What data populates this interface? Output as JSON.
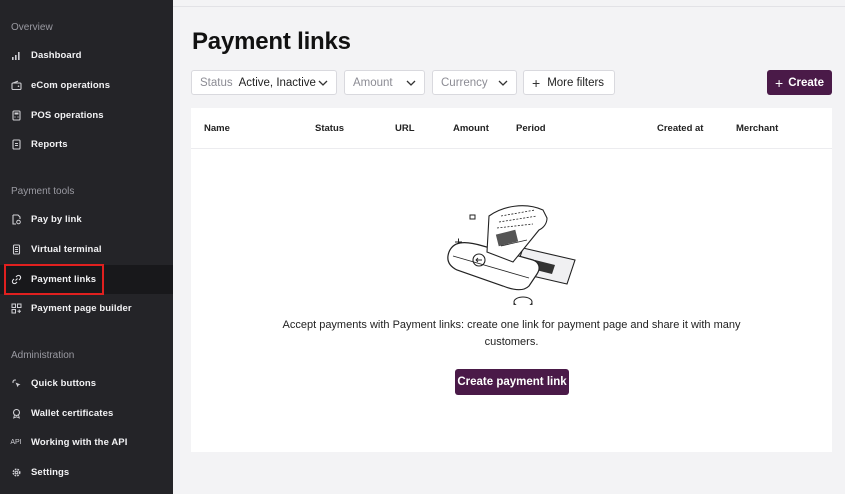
{
  "sidebar": {
    "sections": [
      {
        "title": "Overview",
        "items": [
          {
            "label": "Dashboard",
            "icon": "bar-chart-icon"
          },
          {
            "label": "eCom operations",
            "icon": "wallet-icon"
          },
          {
            "label": "POS operations",
            "icon": "pos-terminal-icon"
          },
          {
            "label": "Reports",
            "icon": "document-icon"
          }
        ]
      },
      {
        "title": "Payment tools",
        "items": [
          {
            "label": "Pay by link",
            "icon": "link-document-icon"
          },
          {
            "label": "Virtual terminal",
            "icon": "calculator-icon"
          },
          {
            "label": "Payment links",
            "icon": "chain-link-icon"
          },
          {
            "label": "Payment page builder",
            "icon": "grid-plus-icon"
          }
        ]
      },
      {
        "title": "Administration",
        "items": [
          {
            "label": "Quick buttons",
            "icon": "cursor-click-icon"
          },
          {
            "label": "Wallet certificates",
            "icon": "certificate-icon"
          },
          {
            "label": "Working with the API",
            "icon": "api-icon",
            "icon_text": "API"
          },
          {
            "label": "Settings",
            "icon": "gear-icon"
          }
        ]
      }
    ],
    "active_item": "Payment links"
  },
  "header": {
    "title": "Payment links"
  },
  "filters": {
    "status_label": "Status",
    "status_value": "Active, Inactive",
    "amount_label": "Amount",
    "currency_label": "Currency",
    "more_filters_label": "More filters",
    "create_label": "Create"
  },
  "table": {
    "columns": [
      "Name",
      "Status",
      "URL",
      "Amount",
      "Period",
      "Created at",
      "Merchant"
    ]
  },
  "empty_state": {
    "message": "Accept payments with Payment links: create one link for payment page and share it with many customers.",
    "cta_label": "Create payment link"
  },
  "colors": {
    "sidebar_bg": "#242428",
    "accent": "#4a1a48",
    "highlight_outline": "#e0201f",
    "page_bg": "#f3f3f5"
  }
}
